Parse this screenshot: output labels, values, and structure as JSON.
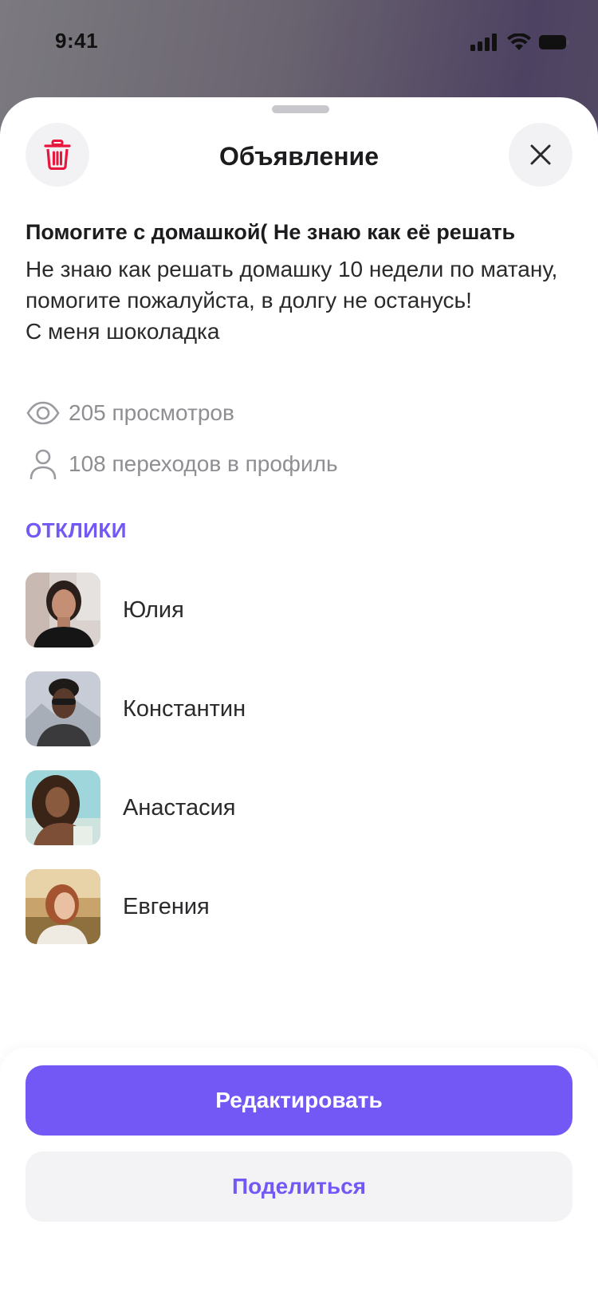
{
  "status_bar": {
    "time": "9:41"
  },
  "header": {
    "title": "Объявление",
    "delete_icon": "trash-icon",
    "close_icon": "close-icon"
  },
  "ad": {
    "title": "Помогите с домашкой( Не знаю как её решать",
    "body": "Не знаю как решать домашку 10 недели по матану, помогите пожалуйста, в долгу не останусь!\nС меня шоколадка"
  },
  "stats": {
    "views": "205 просмотров",
    "profile_visits": "108 переходов в профиль"
  },
  "responses": {
    "label": "ОТКЛИКИ",
    "items": [
      {
        "name": "Юлия"
      },
      {
        "name": "Константин"
      },
      {
        "name": "Анастасия"
      },
      {
        "name": "Евгения"
      }
    ]
  },
  "actions": {
    "edit": "Редактировать",
    "share": "Поделиться"
  },
  "colors": {
    "accent": "#7358f5",
    "delete": "#e8163c"
  }
}
